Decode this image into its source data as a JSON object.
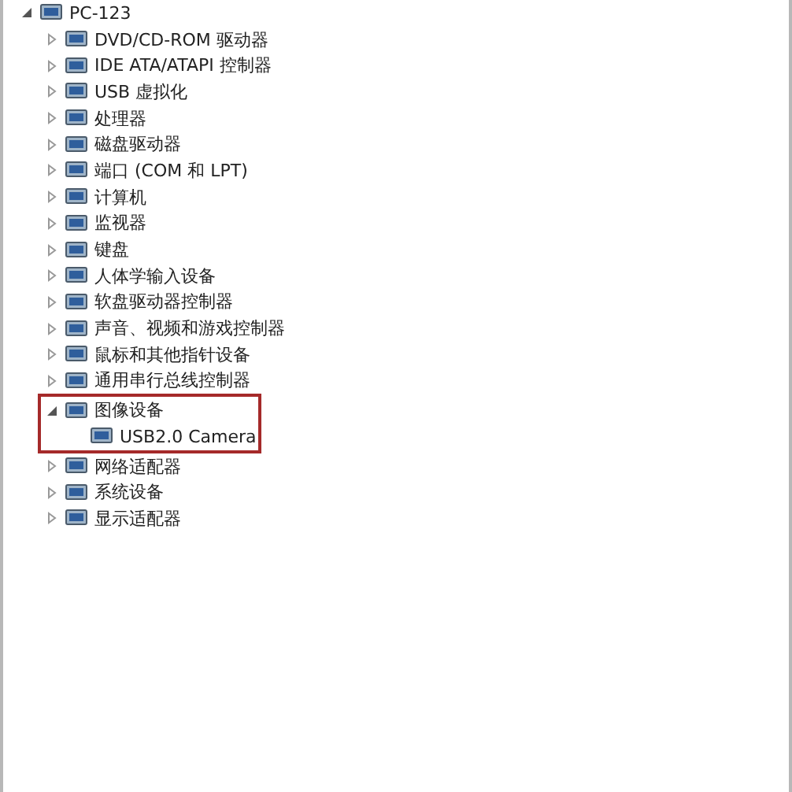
{
  "tree": [
    {
      "label": "PC-123",
      "expanded": true,
      "children": [
        {
          "label": "DVD/CD-ROM 驱动器",
          "expanded": false
        },
        {
          "label": "IDE ATA/ATAPI 控制器",
          "expanded": false
        },
        {
          "label": "USB 虚拟化",
          "expanded": false
        },
        {
          "label": "处理器",
          "expanded": false
        },
        {
          "label": "磁盘驱动器",
          "expanded": false
        },
        {
          "label": "端口 (COM 和 LPT)",
          "expanded": false
        },
        {
          "label": "计算机",
          "expanded": false
        },
        {
          "label": "监视器",
          "expanded": false
        },
        {
          "label": "键盘",
          "expanded": false
        },
        {
          "label": "人体学输入设备",
          "expanded": false
        },
        {
          "label": "软盘驱动器控制器",
          "expanded": false
        },
        {
          "label": "声音、视频和游戏控制器",
          "expanded": false
        },
        {
          "label": "鼠标和其他指针设备",
          "expanded": false
        },
        {
          "label": "通用串行总线控制器",
          "expanded": false
        },
        {
          "label": "图像设备",
          "expanded": true,
          "highlighted": true,
          "children": [
            {
              "label": "USB2.0 Camera"
            }
          ]
        },
        {
          "label": "网络适配器",
          "expanded": false
        },
        {
          "label": "系统设备",
          "expanded": false
        },
        {
          "label": "显示适配器",
          "expanded": false
        }
      ]
    }
  ]
}
